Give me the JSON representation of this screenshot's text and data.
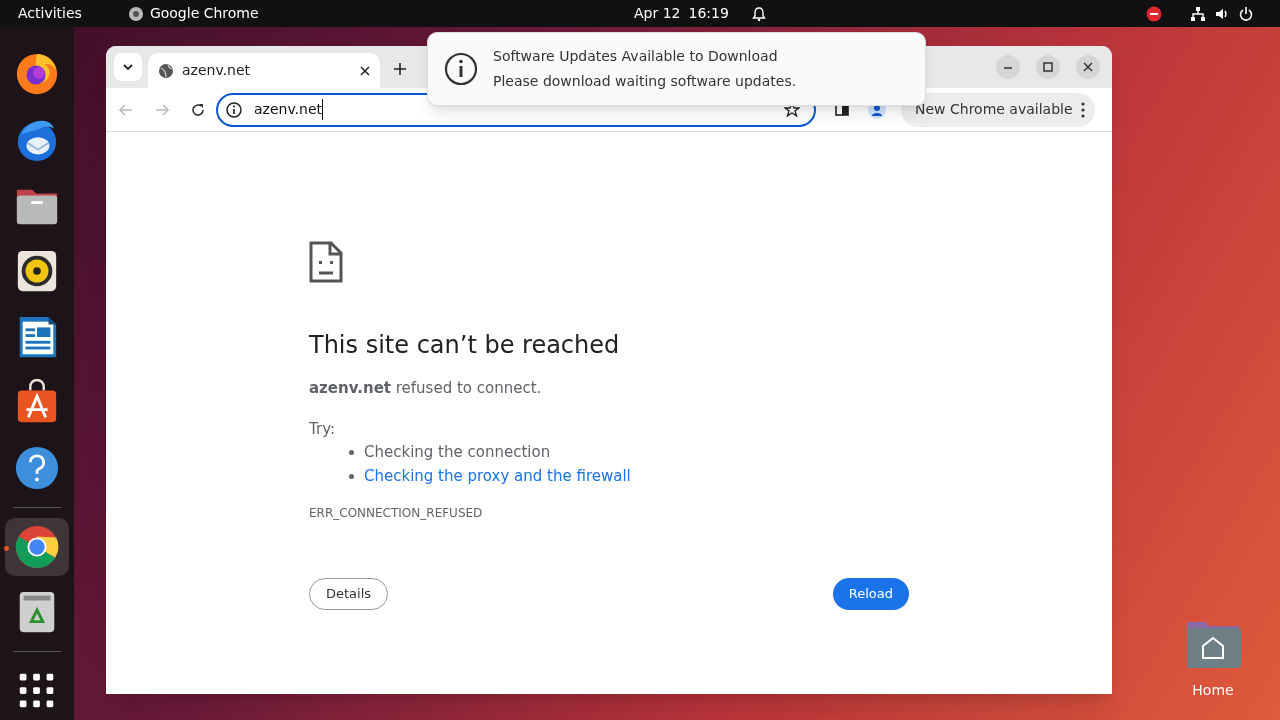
{
  "top_bar": {
    "activities": "Activities",
    "app_name": "Google Chrome",
    "date": "Apr 12",
    "time": "16:19"
  },
  "dock": [
    {
      "kind": "firefox",
      "selected": false
    },
    {
      "kind": "thunderbird",
      "selected": false
    },
    {
      "kind": "files",
      "selected": false
    },
    {
      "kind": "rhythmbox",
      "selected": false
    },
    {
      "kind": "writer",
      "selected": false
    },
    {
      "kind": "appcenter",
      "selected": false
    },
    {
      "kind": "help",
      "selected": false
    },
    {
      "kind": "chrome",
      "selected": true
    },
    {
      "kind": "trash",
      "selected": false
    },
    {
      "kind": "apps",
      "selected": false
    }
  ],
  "browser": {
    "tab": {
      "title": "azenv.net"
    },
    "address": "azenv.net",
    "update_chip": "New Chrome available",
    "error": {
      "title": "This site can’t be reached",
      "message": "**azenv.net** refused to connect.",
      "try_label": "Try:",
      "suggestions": [
        {
          "text": "Checking the connection",
          "kind": "text"
        },
        {
          "text": "Checking the proxy and the firewall",
          "kind": "link"
        }
      ],
      "code": "ERR_CONNECTION_REFUSED",
      "details_button": "Details",
      "reload_button": "Reload"
    }
  },
  "notification": {
    "title": "Software Updates Available to Download",
    "body": "Please download waiting software updates."
  },
  "desktop_icon": {
    "label": "Home"
  }
}
